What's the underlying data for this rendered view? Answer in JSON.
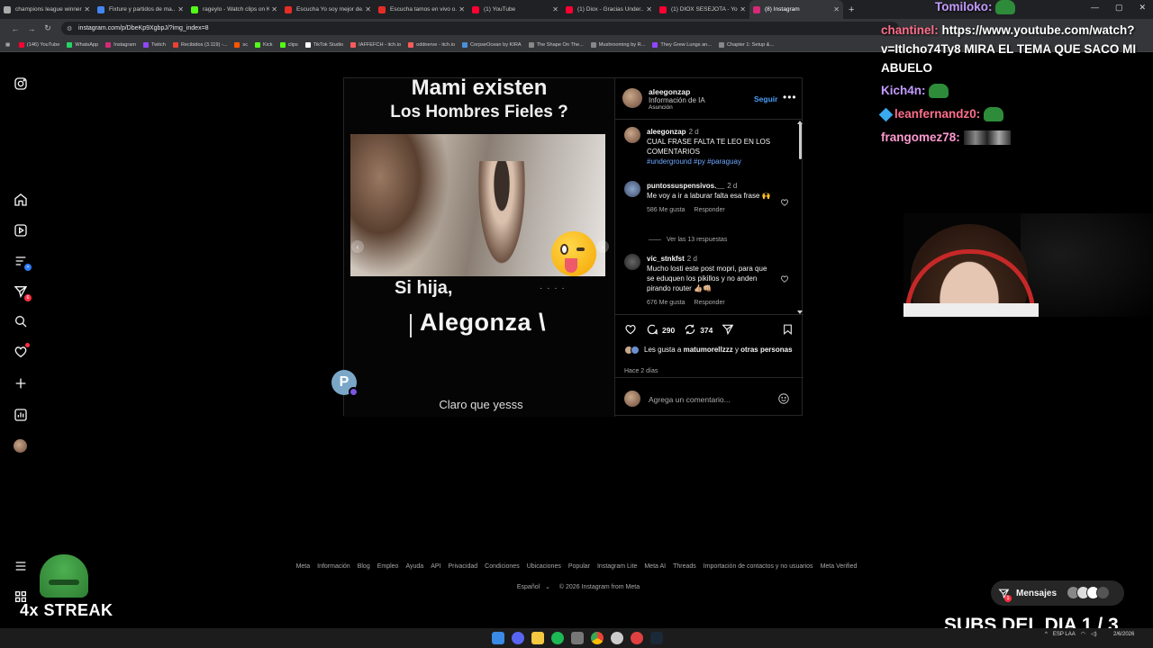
{
  "browser": {
    "tabs": [
      {
        "title": "champions league winner...",
        "color": "#aaaaaa",
        "active": false
      },
      {
        "title": "Fixture y partidos de ma...",
        "color": "#4285f4",
        "active": false
      },
      {
        "title": "rageylo - Watch clips on K...",
        "color": "#53fc18",
        "active": false
      },
      {
        "title": "Escucha Yo soy mejor de...",
        "color": "#e52d27",
        "active": false
      },
      {
        "title": "Escucha tamos en vivo o...",
        "color": "#e52d27",
        "active": false
      },
      {
        "title": "(1) YouTube",
        "color": "#ff0033",
        "active": false
      },
      {
        "title": "(1) Diox - Gracias Under...",
        "color": "#ff0033",
        "active": false
      },
      {
        "title": "(1) DIOX SESEJOTA - You...",
        "color": "#ff0033",
        "active": false
      },
      {
        "title": "(8) Instagram",
        "color": "#d62976",
        "active": true
      }
    ],
    "url": "instagram.com/p/DbeKp9XgbpJ/?img_index=8",
    "bookmarks": [
      {
        "label": "(146) YouTube",
        "color": "#ff0033"
      },
      {
        "label": "WhatsApp",
        "color": "#25d366"
      },
      {
        "label": "Instagram",
        "color": "#d62976"
      },
      {
        "label": "Twitch",
        "color": "#9146ff"
      },
      {
        "label": "Recibidos (3.119) -...",
        "color": "#ea4335"
      },
      {
        "label": "sc",
        "color": "#ff5500"
      },
      {
        "label": "Kick",
        "color": "#53fc18"
      },
      {
        "label": "clips",
        "color": "#53fc18"
      },
      {
        "label": "TikTok Studio",
        "color": "#ffffff"
      },
      {
        "label": "IAFFEFCH - itch.io",
        "color": "#fa5c5c"
      },
      {
        "label": "oddnerve - itch.io",
        "color": "#fa5c5c"
      },
      {
        "label": "CorpseOcean by KIRA",
        "color": "#4a90d9"
      },
      {
        "label": "The Shape On The...",
        "color": "#888888"
      },
      {
        "label": "Mushrooming by R...",
        "color": "#888888"
      },
      {
        "label": "They Grew Lungs an...",
        "color": "#9146ff"
      },
      {
        "label": "Chapter 1: Setup &...",
        "color": "#888888"
      }
    ]
  },
  "post": {
    "media": {
      "caption_top": "Mami existen",
      "caption_sub": "Los Hombres Fieles ?",
      "line_si_hija": "Si hija,",
      "line_si_hija_tail": "· · · ·",
      "line_alegonza": "Alegonza \\",
      "line_claro": "Claro que yesss"
    },
    "header": {
      "username": "aleegonzap",
      "sub1": "Información de IA",
      "sub2": "Asunción",
      "follow": "Seguir"
    },
    "comments": [
      {
        "user": "aleegonzap",
        "time": "2 d",
        "text": "CUAL FRASE FALTA TE LEO EN LOS COMENTARIOS",
        "tags": "#underground #py #paraguay"
      },
      {
        "user": "puntossuspensivos.__",
        "time": "2 d",
        "text": "Me voy a ir a laburar falta esa frase 🙌",
        "likes": "586 Me gusta",
        "reply": "Responder"
      },
      {
        "user": "vic_stnkfst",
        "time": "2 d",
        "text": "Mucho losti este post mopri, para que se eduquen los pikillos y no anden pirando router 👍🏼👊🏼",
        "likes": "676 Me gusta",
        "reply": "Responder"
      }
    ],
    "view_replies": "Ver las 13 respuestas",
    "comment_count": "290",
    "share_count": "374",
    "likes_prefix": "Les gusta a ",
    "likes_user": "matumorellzzz",
    "likes_suffix": " y ",
    "likes_others": "otras personas",
    "ago": "Hace 2 días",
    "add_comment_placeholder": "Agrega un comentario..."
  },
  "footer": {
    "links": [
      "Meta",
      "Información",
      "Blog",
      "Empleo",
      "Ayuda",
      "API",
      "Privacidad",
      "Condiciones",
      "Ubicaciones",
      "Popular",
      "Instagram Lite",
      "Meta AI",
      "Threads",
      "Importación de contactos y no usuarios",
      "Meta Verified"
    ],
    "language": "Español",
    "copyright": "© 2026 Instagram from Meta"
  },
  "rail": {
    "badge_reels": "6",
    "badge_explore": "+"
  },
  "messages": {
    "label": "Mensajes",
    "badge": "1"
  },
  "chat": {
    "top_user": "Tomiloko:",
    "line1_user": "chantinel:",
    "line1_msg": " https://www.youtube.com/watch?",
    "line2": "v=Itlcho74Ty8 MIRA EL TEMA QUE SACO MI",
    "line3": "ABUELO",
    "line4_user": "Kich4n:",
    "line5_user": "leanfernandz0:",
    "line6_user": "frangomez78:"
  },
  "overlay": {
    "streak": "4x STREAK",
    "subs": "SUBS DEL DIA 1 / 3"
  },
  "taskbar": {
    "lang": "ESP LAA",
    "time": "",
    "date": "2/6/2026"
  }
}
